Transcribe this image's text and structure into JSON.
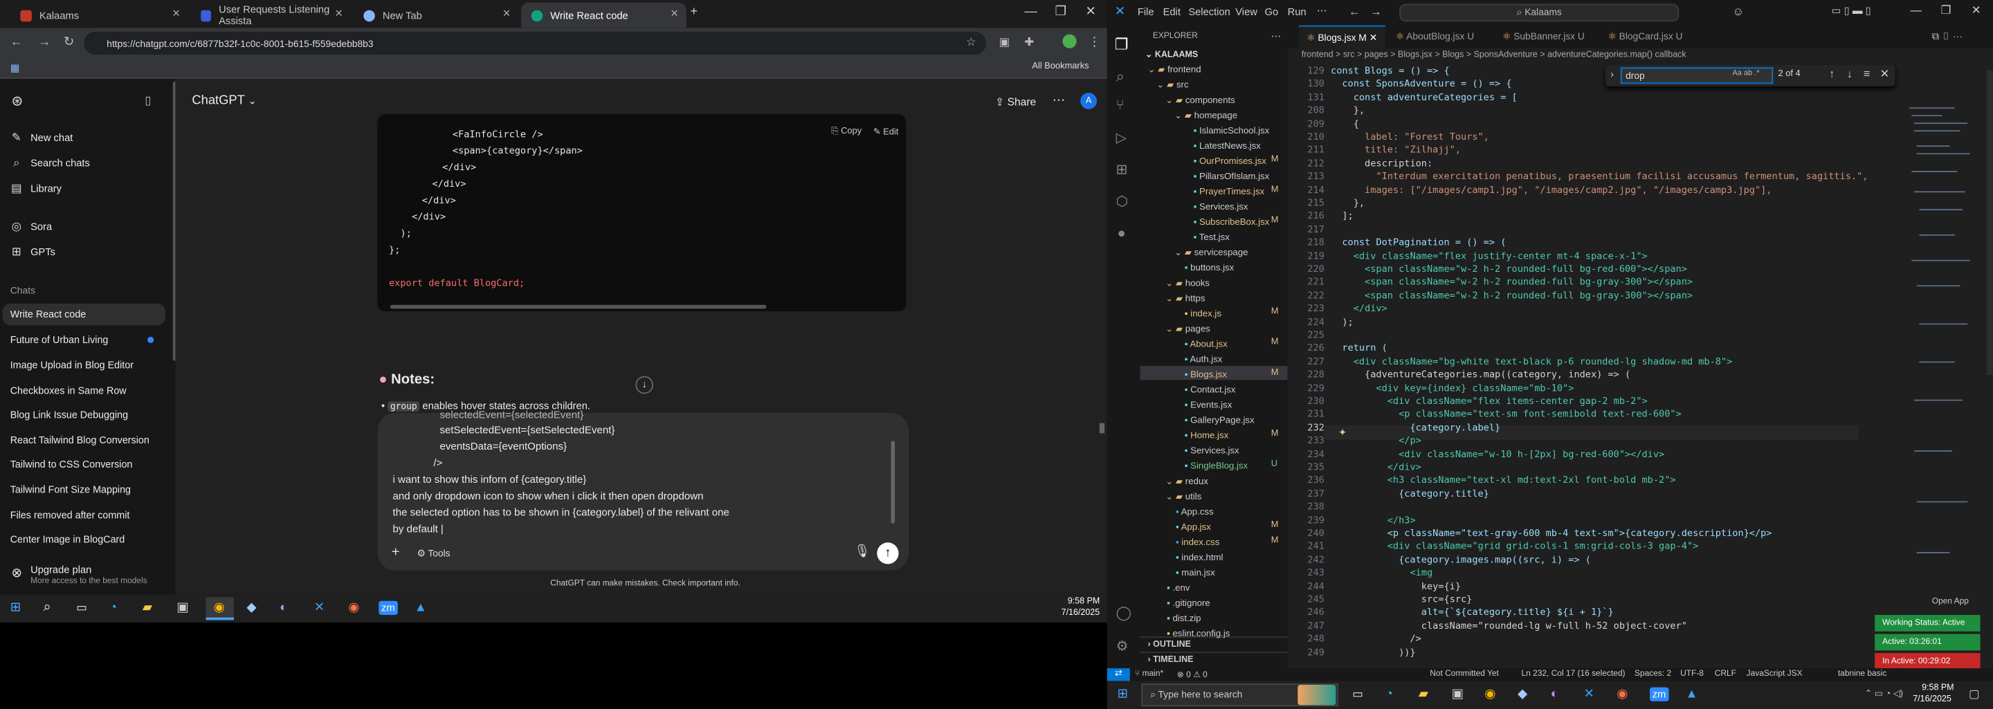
{
  "browser": {
    "tabs": [
      {
        "title": "Kalaams",
        "color": "#c0392b"
      },
      {
        "title": "User Requests Listening Assista",
        "color": "#3b5fd9"
      },
      {
        "title": "New Tab",
        "color": "#8ab4f8"
      },
      {
        "title": "Write React code",
        "color": "#10a37f"
      }
    ],
    "url": "https://chatgpt.com/c/6877b32f-1c0c-8001-b615-f559edebb8b3",
    "all_bookmarks": "All Bookmarks"
  },
  "gpt": {
    "model": "ChatGPT",
    "share": "Share",
    "avatar": "A",
    "nav": [
      {
        "label": "New chat",
        "icon": "pencil-icon"
      },
      {
        "label": "Search chats",
        "icon": "search-icon"
      },
      {
        "label": "Library",
        "icon": "library-icon"
      },
      {
        "label": "Sora",
        "icon": "sora-icon"
      },
      {
        "label": "GPTs",
        "icon": "gpts-icon"
      }
    ],
    "chats_heading": "Chats",
    "chats": [
      "Write React code",
      "Future of Urban Living",
      "Image Upload in Blog Editor",
      "Checkboxes in Same Row",
      "Blog Link Issue Debugging",
      "React Tailwind Blog Conversion",
      "Tailwind to CSS Conversion",
      "Tailwind Font Size Mapping",
      "Files removed after commit",
      "Center Image in BlogCard"
    ],
    "upgrade": "Upgrade plan",
    "upgrade_sub": "More access to the best models",
    "copy": "Copy",
    "edit": "Edit",
    "code_lines": [
      "<FaInfoCircle />",
      "<span>{category}</span>",
      "</div>",
      "</div>",
      "</div>",
      "</div>",
      ");",
      "};",
      "",
      "export default BlogCard;"
    ],
    "notes_title": "Notes:",
    "note_code": "group",
    "note_text": " enables hover states across children.",
    "composer_lines": [
      "selectedEvent={selectedEvent}",
      "setSelectedEvent={setSelectedEvent}",
      "eventsData={eventOptions}",
      "/>",
      "i want to show this inforn of {category.title}",
      "and only dropdown icon to show when i click it then open dropdown",
      "the selected option has to be shown in {category.label} of the relivant one",
      "by default |"
    ],
    "tools": "Tools",
    "disclaimer": "ChatGPT can make mistakes. Check important info."
  },
  "taskbar_left": {
    "time": "9:58 PM",
    "date": "7/16/2025"
  },
  "vscode": {
    "menu": [
      "File",
      "Edit",
      "Selection",
      "View",
      "Go",
      "Run"
    ],
    "search": "Kalaams",
    "explorer_title": "EXPLORER",
    "project": "KALAAMS",
    "tree": [
      {
        "name": "frontend",
        "indent": 0,
        "type": "folder"
      },
      {
        "name": "src",
        "indent": 1,
        "type": "folder"
      },
      {
        "name": "components",
        "indent": 2,
        "type": "folder"
      },
      {
        "name": "homepage",
        "indent": 3,
        "type": "folder"
      },
      {
        "name": "IslamicSchool.jsx",
        "indent": 4,
        "type": "file",
        "status": ""
      },
      {
        "name": "LatestNews.jsx",
        "indent": 4,
        "type": "file",
        "status": ""
      },
      {
        "name": "OurPromises.jsx",
        "indent": 4,
        "type": "file",
        "status": "M"
      },
      {
        "name": "PillarsOfIslam.jsx",
        "indent": 4,
        "type": "file",
        "status": ""
      },
      {
        "name": "PrayerTimes.jsx",
        "indent": 4,
        "type": "file",
        "status": "M"
      },
      {
        "name": "Services.jsx",
        "indent": 4,
        "type": "file",
        "status": ""
      },
      {
        "name": "SubscribeBox.jsx",
        "indent": 4,
        "type": "file",
        "status": "M"
      },
      {
        "name": "Test.jsx",
        "indent": 4,
        "type": "file",
        "status": ""
      },
      {
        "name": "servicespage",
        "indent": 3,
        "type": "folder"
      },
      {
        "name": "buttons.jsx",
        "indent": 3,
        "type": "file",
        "status": ""
      },
      {
        "name": "hooks",
        "indent": 2,
        "type": "folder"
      },
      {
        "name": "https",
        "indent": 2,
        "type": "folder"
      },
      {
        "name": "index.js",
        "indent": 3,
        "type": "file",
        "status": "M"
      },
      {
        "name": "pages",
        "indent": 2,
        "type": "folder"
      },
      {
        "name": "About.jsx",
        "indent": 3,
        "type": "file",
        "status": "M"
      },
      {
        "name": "Auth.jsx",
        "indent": 3,
        "type": "file",
        "status": ""
      },
      {
        "name": "Blogs.jsx",
        "indent": 3,
        "type": "file",
        "status": "M"
      },
      {
        "name": "Contact.jsx",
        "indent": 3,
        "type": "file",
        "status": ""
      },
      {
        "name": "Events.jsx",
        "indent": 3,
        "type": "file",
        "status": ""
      },
      {
        "name": "GalleryPage.jsx",
        "indent": 3,
        "type": "file",
        "status": ""
      },
      {
        "name": "Home.jsx",
        "indent": 3,
        "type": "file",
        "status": "M"
      },
      {
        "name": "Services.jsx",
        "indent": 3,
        "type": "file",
        "status": ""
      },
      {
        "name": "SingleBlog.jsx",
        "indent": 3,
        "type": "file",
        "status": "U"
      },
      {
        "name": "redux",
        "indent": 2,
        "type": "folder"
      },
      {
        "name": "utils",
        "indent": 2,
        "type": "folder"
      },
      {
        "name": "App.css",
        "indent": 2,
        "type": "file",
        "status": ""
      },
      {
        "name": "App.jsx",
        "indent": 2,
        "type": "file",
        "status": "M"
      },
      {
        "name": "index.css",
        "indent": 2,
        "type": "file",
        "status": "M"
      },
      {
        "name": "index.html",
        "indent": 2,
        "type": "file",
        "status": ""
      },
      {
        "name": "main.jsx",
        "indent": 2,
        "type": "file",
        "status": ""
      },
      {
        "name": ".env",
        "indent": 1,
        "type": "file",
        "status": ""
      },
      {
        "name": ".gitignore",
        "indent": 1,
        "type": "file",
        "status": ""
      },
      {
        "name": "dist.zip",
        "indent": 1,
        "type": "file",
        "status": ""
      },
      {
        "name": "eslint.config.js",
        "indent": 1,
        "type": "file",
        "status": ""
      }
    ],
    "outline": "OUTLINE",
    "timeline": "TIMELINE",
    "tabs": [
      {
        "label": "Blogs.jsx M"
      },
      {
        "label": "AboutBlog.jsx U"
      },
      {
        "label": "SubBanner.jsx U"
      },
      {
        "label": "BlogCard.jsx U"
      }
    ],
    "breadcrumb": "frontend > src > pages > Blogs.jsx > Blogs > SponsAdventure > adventureCategories.map() callback",
    "find": {
      "value": "drop",
      "count": "2 of 4"
    },
    "code": [
      {
        "n": "129",
        "t": "const Blogs = () => {"
      },
      {
        "n": "130",
        "t": "  const SponsAdventure = () => {"
      },
      {
        "n": "131",
        "t": "    const adventureCategories = ["
      },
      {
        "n": "208",
        "t": "    },"
      },
      {
        "n": "209",
        "t": "    {"
      },
      {
        "n": "210",
        "t": "      label: \"Forest Tours\","
      },
      {
        "n": "211",
        "t": "      title: \"Zilhajj\","
      },
      {
        "n": "212",
        "t": "      description:"
      },
      {
        "n": "213",
        "t": "        \"Interdum exercitation penatibus, praesentium facilisi accusamus fermentum, sagittis.\","
      },
      {
        "n": "214",
        "t": "      images: [\"/images/camp1.jpg\", \"/images/camp2.jpg\", \"/images/camp3.jpg\"],"
      },
      {
        "n": "215",
        "t": "    },"
      },
      {
        "n": "216",
        "t": "  ];"
      },
      {
        "n": "217",
        "t": ""
      },
      {
        "n": "218",
        "t": "  const DotPagination = () => ("
      },
      {
        "n": "219",
        "t": "    <div className=\"flex justify-center mt-4 space-x-1\">"
      },
      {
        "n": "220",
        "t": "      <span className=\"w-2 h-2 rounded-full bg-red-600\"></span>"
      },
      {
        "n": "221",
        "t": "      <span className=\"w-2 h-2 rounded-full bg-gray-300\"></span>"
      },
      {
        "n": "222",
        "t": "      <span className=\"w-2 h-2 rounded-full bg-gray-300\"></span>"
      },
      {
        "n": "223",
        "t": "    </div>"
      },
      {
        "n": "224",
        "t": "  );"
      },
      {
        "n": "225",
        "t": ""
      },
      {
        "n": "226",
        "t": "  return ("
      },
      {
        "n": "227",
        "t": "    <div className=\"bg-white text-black p-6 rounded-lg shadow-md mb-8\">"
      },
      {
        "n": "228",
        "t": "      {adventureCategories.map((category, index) => ("
      },
      {
        "n": "229",
        "t": "        <div key={index} className=\"mb-10\">"
      },
      {
        "n": "230",
        "t": "          <div className=\"flex items-center gap-2 mb-2\">"
      },
      {
        "n": "231",
        "t": "            <p className=\"text-sm font-semibold text-red-600\">"
      },
      {
        "n": "232",
        "t": "              {category.label}"
      },
      {
        "n": "233",
        "t": "            </p>"
      },
      {
        "n": "234",
        "t": "            <div className=\"w-10 h-[2px] bg-red-600\"></div>"
      },
      {
        "n": "235",
        "t": "          </div>"
      },
      {
        "n": "236",
        "t": "          <h3 className=\"text-xl md:text-2xl font-bold mb-2\">"
      },
      {
        "n": "237",
        "t": "            {category.title}"
      },
      {
        "n": "238",
        "t": ""
      },
      {
        "n": "239",
        "t": "          </h3>"
      },
      {
        "n": "240",
        "t": "          <p className=\"text-gray-600 mb-4 text-sm\">{category.description}</p>"
      },
      {
        "n": "241",
        "t": "          <div className=\"grid grid-cols-1 sm:grid-cols-3 gap-4\">"
      },
      {
        "n": "242",
        "t": "            {category.images.map((src, i) => ("
      },
      {
        "n": "243",
        "t": "              <img"
      },
      {
        "n": "244",
        "t": "                key={i}"
      },
      {
        "n": "245",
        "t": "                src={src}"
      },
      {
        "n": "246",
        "t": "                alt={`${category.title} ${i + 1}`}"
      },
      {
        "n": "247",
        "t": "                className=\"rounded-lg w-full h-52 object-cover\""
      },
      {
        "n": "248",
        "t": "              />"
      },
      {
        "n": "249",
        "t": "            ))}"
      }
    ],
    "status": {
      "branch": "main*",
      "errors": "0 ⚠ 0",
      "commit": "Not Committed Yet",
      "pos": "Ln 232, Col 17 (16 selected)",
      "spaces": "Spaces: 2",
      "enc": "UTF-8",
      "eol": "CRLF",
      "lang": "JavaScript JSX",
      "tabnine": "tabnine basic"
    },
    "working": [
      {
        "label": "Working Status: Active",
        "color": "#1e8e3e"
      },
      {
        "label": "Active: 03:26:01",
        "color": "#1e8e3e"
      },
      {
        "label": "In Active: 00:29:02",
        "color": "#c62828"
      }
    ],
    "open_app": "Open App"
  },
  "taskbar_right": {
    "search": "Type here to search",
    "time": "9:58 PM",
    "date": "7/16/2025"
  }
}
